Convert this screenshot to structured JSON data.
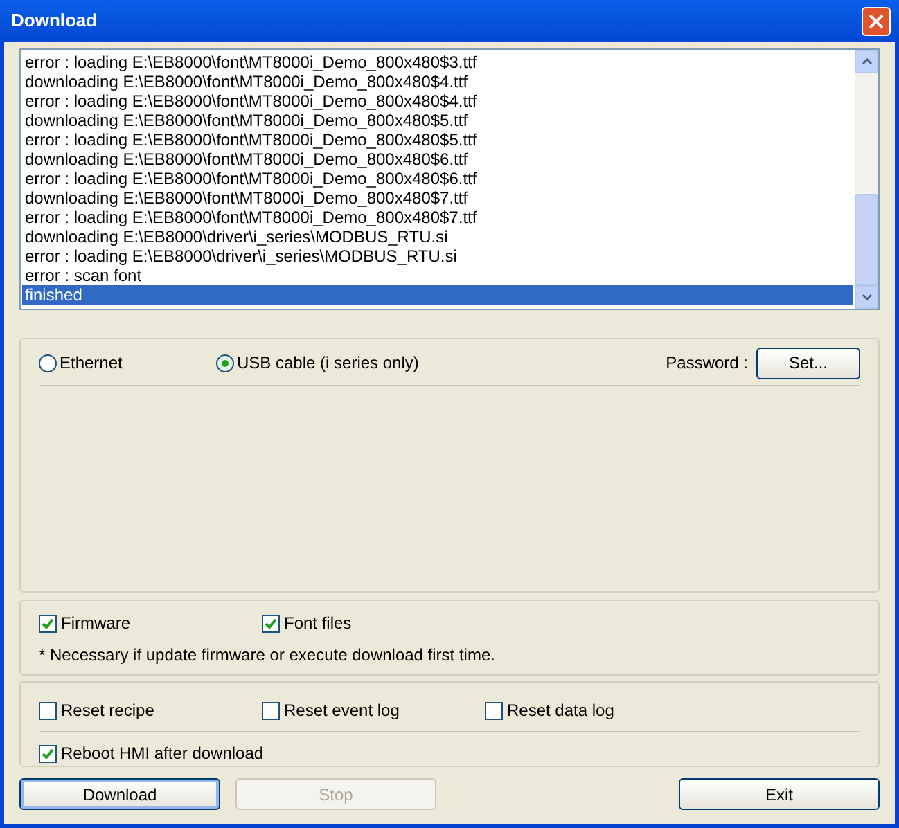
{
  "window": {
    "title": "Download"
  },
  "log": {
    "lines": [
      {
        "text": "error : loading E:\\EB8000\\font\\MT8000i_Demo_800x480$3.ttf",
        "selected": false
      },
      {
        "text": "downloading E:\\EB8000\\font\\MT8000i_Demo_800x480$4.ttf",
        "selected": false
      },
      {
        "text": "error : loading E:\\EB8000\\font\\MT8000i_Demo_800x480$4.ttf",
        "selected": false
      },
      {
        "text": "downloading E:\\EB8000\\font\\MT8000i_Demo_800x480$5.ttf",
        "selected": false
      },
      {
        "text": "error : loading E:\\EB8000\\font\\MT8000i_Demo_800x480$5.ttf",
        "selected": false
      },
      {
        "text": "downloading E:\\EB8000\\font\\MT8000i_Demo_800x480$6.ttf",
        "selected": false
      },
      {
        "text": "error : loading E:\\EB8000\\font\\MT8000i_Demo_800x480$6.ttf",
        "selected": false
      },
      {
        "text": "downloading E:\\EB8000\\font\\MT8000i_Demo_800x480$7.ttf",
        "selected": false
      },
      {
        "text": "error : loading E:\\EB8000\\font\\MT8000i_Demo_800x480$7.ttf",
        "selected": false
      },
      {
        "text": "downloading E:\\EB8000\\driver\\i_series\\MODBUS_RTU.si",
        "selected": false
      },
      {
        "text": "error : loading E:\\EB8000\\driver\\i_series\\MODBUS_RTU.si",
        "selected": false
      },
      {
        "text": "error : scan font",
        "selected": false
      },
      {
        "text": "finished",
        "selected": true
      }
    ]
  },
  "connection": {
    "options": [
      {
        "label": "Ethernet",
        "selected": false
      },
      {
        "label": "USB cable (i series only)",
        "selected": true
      }
    ],
    "password_label": "Password :",
    "set_button": "Set..."
  },
  "files": {
    "checkboxes": [
      {
        "label": "Firmware",
        "checked": true
      },
      {
        "label": "Font files",
        "checked": true
      }
    ],
    "note": "* Necessary if update firmware or execute download first time."
  },
  "reset": {
    "checkboxes": [
      {
        "label": "Reset recipe",
        "checked": false
      },
      {
        "label": "Reset event log",
        "checked": false
      },
      {
        "label": "Reset data log",
        "checked": false
      }
    ],
    "reboot": {
      "label": "Reboot HMI after download",
      "checked": true
    }
  },
  "buttons": [
    {
      "label": "Download",
      "disabled": false,
      "default": true
    },
    {
      "label": "Stop",
      "disabled": true,
      "default": false
    },
    {
      "label": "Exit",
      "disabled": false,
      "default": false
    }
  ]
}
